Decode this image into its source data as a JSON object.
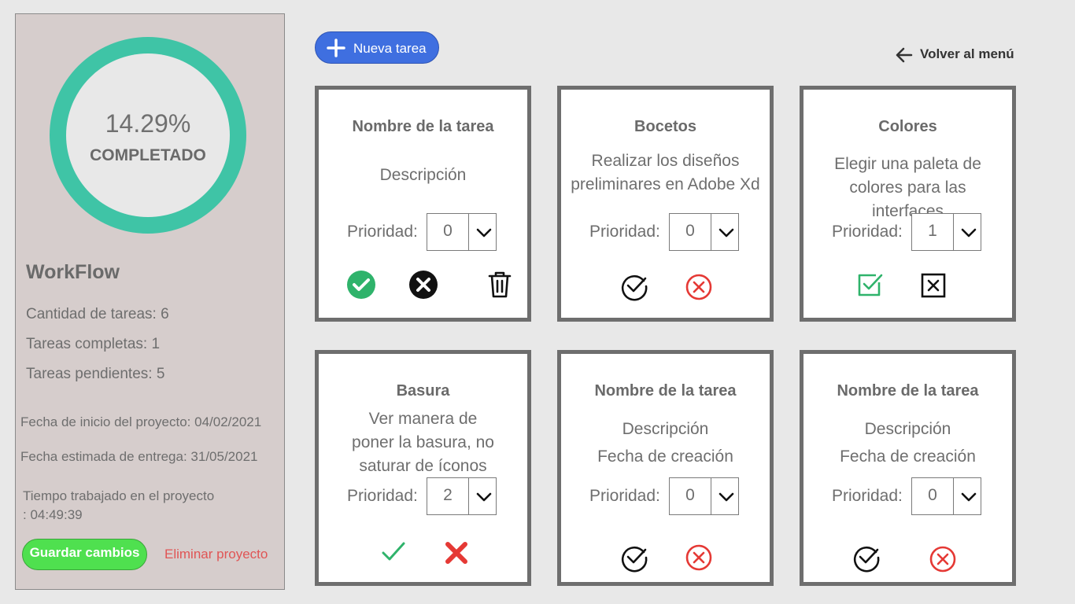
{
  "sidebar": {
    "progress_percent": "14.29%",
    "progress_value": 14.29,
    "progress_label": "COMPLETADO",
    "project_name": "WorkFlow",
    "stats": {
      "total": "Cantidad de tareas: 6",
      "done": "Tareas completas: 1",
      "pending": "Tareas pendientes: 5"
    },
    "start_date": "Fecha de inicio del proyecto: 04/02/2021",
    "due_date": "Fecha estimada de entrega: 31/05/2021",
    "worked_line1": "Tiempo trabajado en el proyecto",
    "worked_line2": ": 04:49:39",
    "save_label": "Guardar cambios",
    "delete_label": "Eliminar proyecto"
  },
  "header": {
    "new_task_label": "Nueva tarea",
    "back_label": "Volver al menú"
  },
  "colors": {
    "accent": "#3f6fe0",
    "ring": "#3fc4a6",
    "save": "#4fe04f",
    "danger": "#e53935",
    "success": "#2fb36b"
  },
  "priority_label": "Prioridad:",
  "cards": [
    {
      "title": "Nombre de la tarea",
      "desc_lines": [
        "Descripción"
      ],
      "priority": "0"
    },
    {
      "title": "Bocetos",
      "desc_lines": [
        "Realizar los diseños",
        "preliminares en Adobe Xd"
      ],
      "priority": "0"
    },
    {
      "title": "Colores",
      "desc_lines": [
        "Elegir una paleta de",
        "colores para las interfaces"
      ],
      "priority": "1"
    },
    {
      "title": "Basura",
      "desc_lines": [
        "Ver manera de",
        "poner la basura, no",
        "saturar de íconos"
      ],
      "priority": "2"
    },
    {
      "title": "Nombre de la tarea",
      "desc_lines": [
        "Descripción",
        "Fecha de creación"
      ],
      "priority": "0"
    },
    {
      "title": "Nombre de la tarea",
      "desc_lines": [
        "Descripción",
        "Fecha de creación"
      ],
      "priority": "0"
    }
  ]
}
